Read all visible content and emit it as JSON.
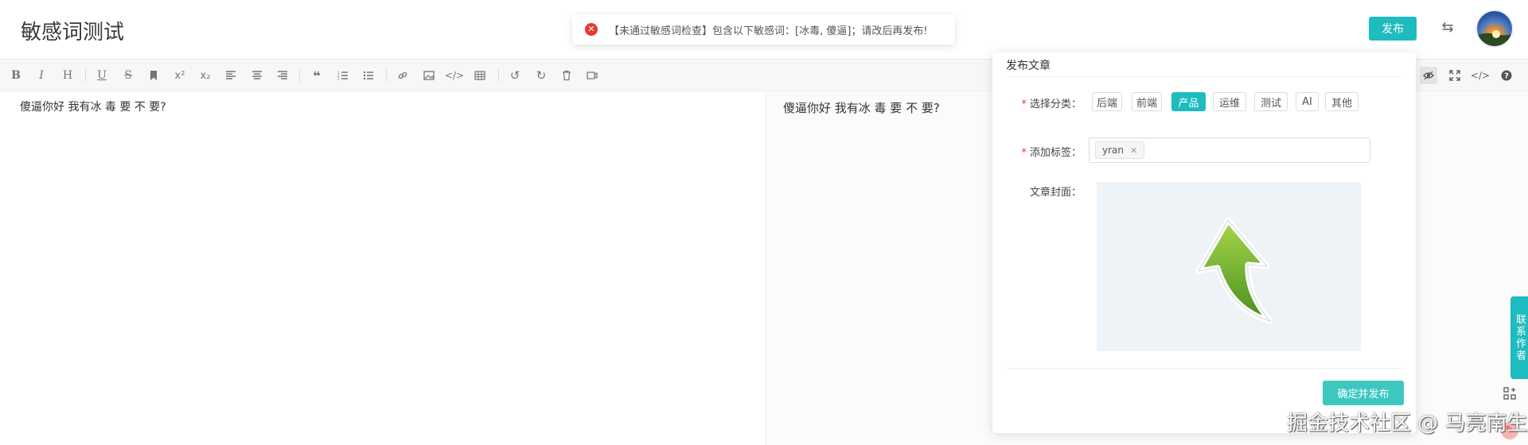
{
  "header": {
    "title": "敏感词测试",
    "publish_label": "发布",
    "swap_glyph": "⇆"
  },
  "toast": {
    "icon": "error-circle-icon",
    "message": "【未通过敏感词检查】包含以下敏感词：[冰毒, 傻逼]；请改后再发布!"
  },
  "toolbar": {
    "items": [
      "bold-icon",
      "italic-icon",
      "heading-icon",
      "underline-icon",
      "strikethrough-icon",
      "bookmark-icon",
      "superscript-icon",
      "subscript-icon",
      "align-left-icon",
      "align-center-icon",
      "align-right-icon",
      "quote-icon",
      "ordered-list-icon",
      "unordered-list-icon",
      "link-icon",
      "image-icon",
      "code-icon",
      "table-icon",
      "undo-icon",
      "redo-icon",
      "trash-icon",
      "save-icon"
    ],
    "right_items": [
      "preview-eye-icon",
      "fullscreen-icon",
      "html-code-icon",
      "help-icon"
    ]
  },
  "editor": {
    "content": "傻逼你好  我有冰  毒  要  不  要?"
  },
  "preview": {
    "content": "傻逼你好  我有冰  毒  要  不  要?"
  },
  "dialog": {
    "title": "发布文章",
    "category_label": "选择分类：",
    "categories": [
      "后端",
      "前端",
      "产品",
      "运维",
      "测试",
      "AI",
      "其他"
    ],
    "selected_category": "产品",
    "tag_label": "添加标签：",
    "tags": [
      "yran"
    ],
    "cover_label": "文章封面：",
    "confirm_label": "确定并发布"
  },
  "sidebar": {
    "contact_label": "联系作者"
  },
  "watermark": "掘金技术社区 @ 马亮南生",
  "colors": {
    "accent": "#1ebbbf",
    "error": "#e8392e"
  }
}
